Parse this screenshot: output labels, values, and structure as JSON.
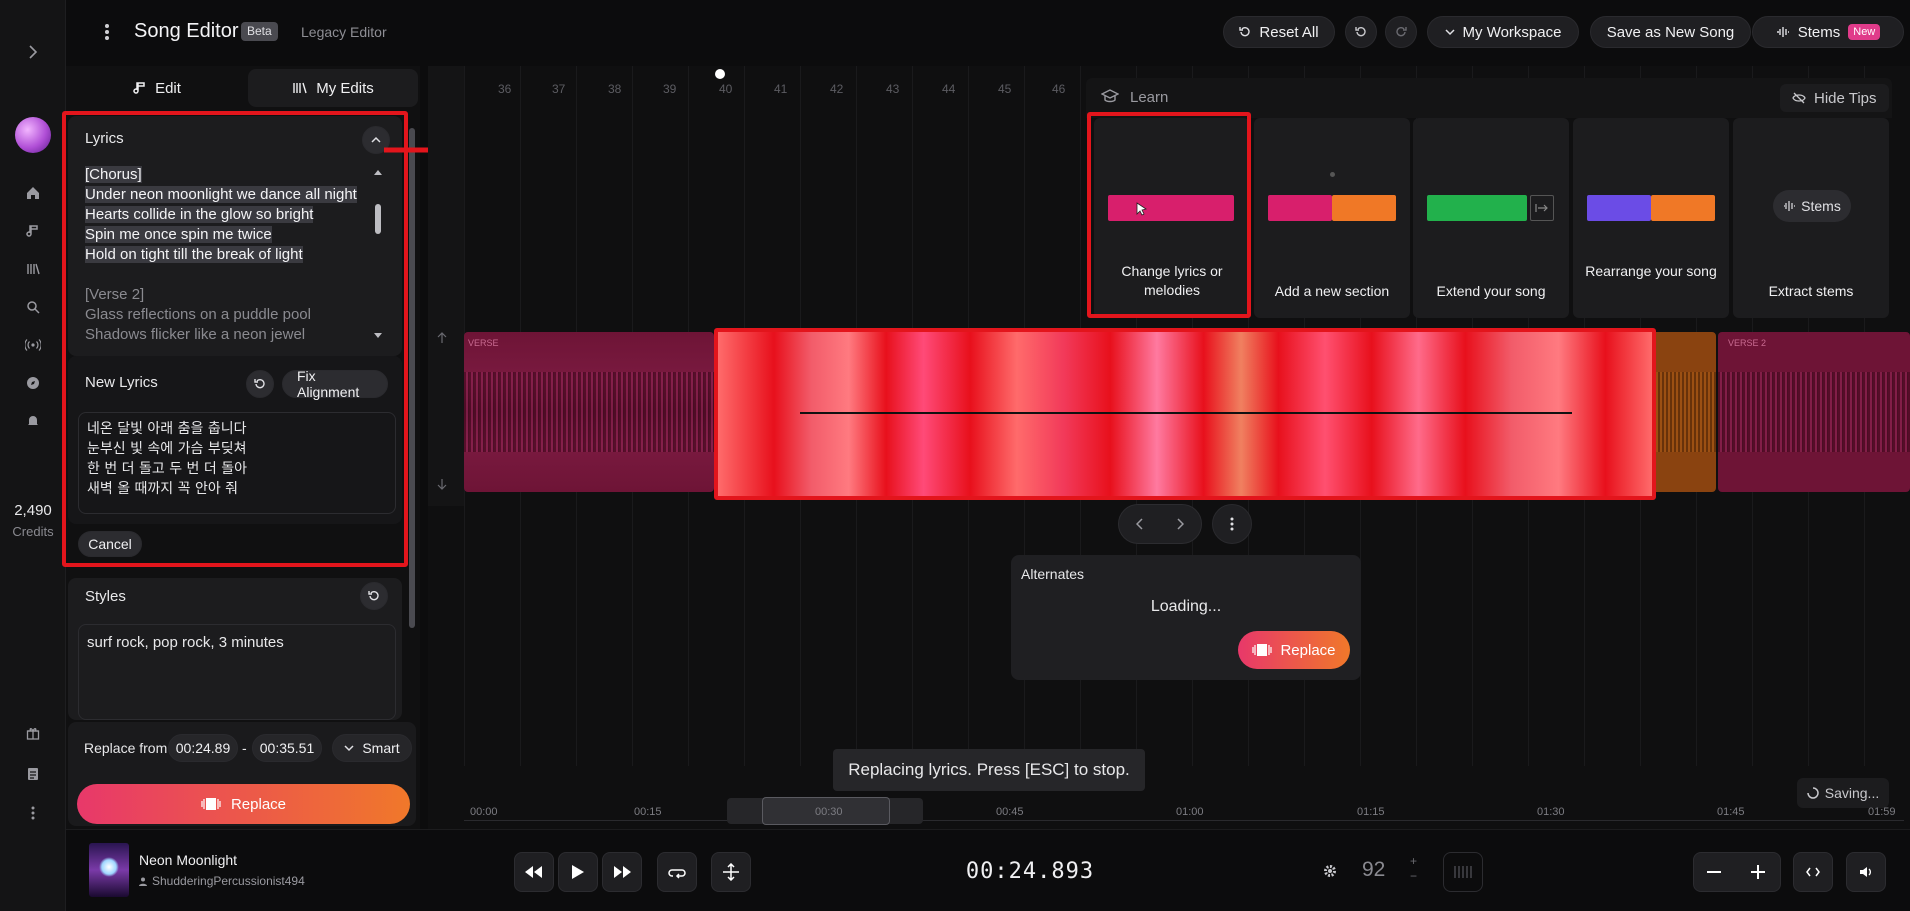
{
  "app": {
    "title": "Song Editor",
    "beta_badge": "Beta",
    "legacy_link": "Legacy Editor"
  },
  "topbar": {
    "reset_all": "Reset All",
    "workspace": "My Workspace",
    "save_new": "Save as New Song",
    "stems": "Stems",
    "stems_badge": "New"
  },
  "sidebar": {
    "credits_value": "2,490",
    "credits_label": "Credits"
  },
  "panel": {
    "tab_edit": "Edit",
    "tab_my_edits": "My Edits",
    "lyrics_title": "Lyrics",
    "lyrics_lines": [
      "[Chorus]",
      "Under neon moonlight we dance all night",
      "Hearts collide in the glow so bright",
      "Spin me once spin me twice",
      "Hold on tight till the break of light",
      "",
      "[Verse 2]",
      "Glass reflections on a puddle pool",
      "Shadows flicker like a neon jewel"
    ],
    "new_lyrics_title": "New Lyrics",
    "fix_alignment": "Fix Alignment",
    "new_lyrics_lines": [
      "네온 달빛 아래 춤을 춥니다",
      "눈부신 빛 속에 가슴 부딪쳐",
      "한 번 더 돌고 두 번 더 돌아",
      "새벽 올 때까지 꼭 안아 줘"
    ],
    "cancel": "Cancel",
    "styles_title": "Styles",
    "styles_value": "surf rock, pop rock, 3 minutes",
    "replace_from_label": "Replace from",
    "replace_start": "00:24.89",
    "replace_dash": "-",
    "replace_end": "00:35.51",
    "smart": "Smart",
    "replace_button": "Replace"
  },
  "timeline": {
    "ruler": [
      "36",
      "37",
      "38",
      "39",
      "40",
      "41",
      "42",
      "43",
      "44",
      "45",
      "46"
    ],
    "learn_title": "Learn",
    "hide_tips": "Hide Tips",
    "tips": [
      {
        "label": "Change lyrics or melodies"
      },
      {
        "label": "Add a new section"
      },
      {
        "label": "Extend your song"
      },
      {
        "label": "Rearrange your song"
      },
      {
        "label": "Extract stems"
      }
    ],
    "stems_chip": "Stems",
    "verse_label": "VERSE",
    "verse2_label": "VERSE 2",
    "alternates_title": "Alternates",
    "alternates_status": "Loading...",
    "alternates_replace": "Replace",
    "toast": "Replacing lyrics. Press [ESC] to stop.",
    "saving": "Saving...",
    "bottom_times": [
      "00:00",
      "00:15",
      "00:30",
      "00:45",
      "01:00",
      "01:15",
      "01:30",
      "01:45",
      "01:59"
    ]
  },
  "player": {
    "song_title": "Neon Moonlight",
    "artist": "ShudderingPercussionist494",
    "time": "00:24.893",
    "bpm": "92"
  },
  "colors": {
    "accent_red": "#e3151c",
    "replace_gradient_start": "#e8386a",
    "replace_gradient_end": "#f0782a",
    "track_pink": "#6e1436",
    "track_orange": "#8a4310"
  }
}
